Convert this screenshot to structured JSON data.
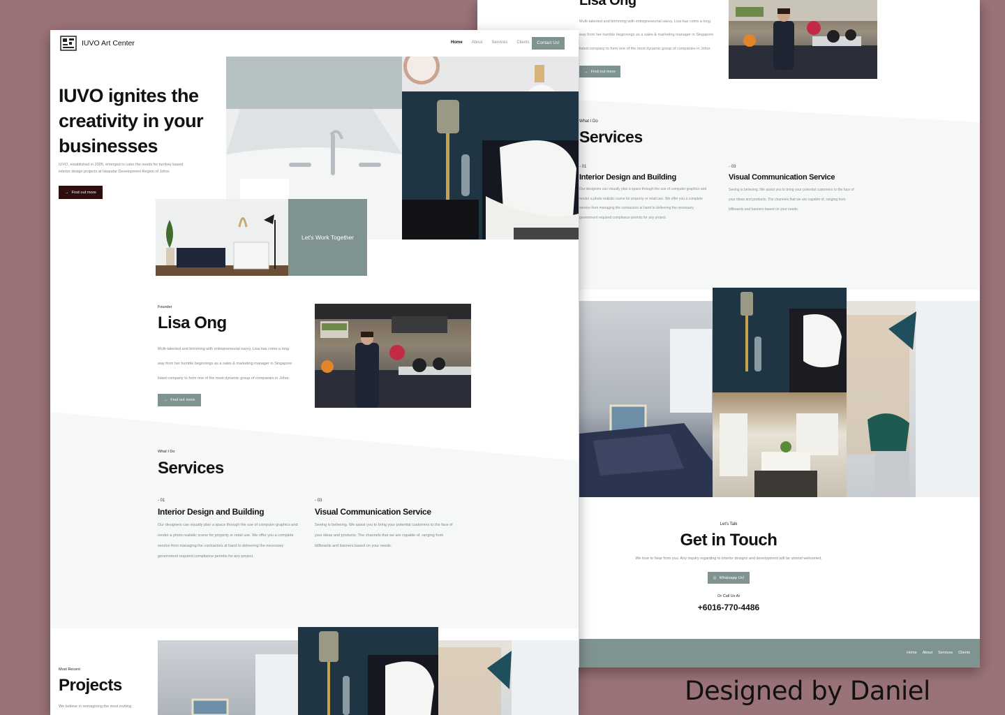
{
  "colors": {
    "backdrop": "#9a7378",
    "accent": "#7f9391",
    "dark_button": "#2e0e0e",
    "light_section": "#f6f8f7"
  },
  "brand": {
    "name": "IUVO Art Center",
    "logo_icon": "iuvo-logo-icon"
  },
  "nav": {
    "items": [
      "Home",
      "About",
      "Services",
      "Clients"
    ],
    "contact_label": "Contact Us!"
  },
  "hero": {
    "title_line1": "IUVO ignites the",
    "title_line2": "creativity in your",
    "title_line3": "businesses",
    "desc_line1": "IUVO, established in 2005, emerged to cater the needs for turnkey based",
    "desc_line2": "interior design projects at Iskandar Development Region of Johor.",
    "cta": "Find out more",
    "cta_icon": "arrow-right-icon",
    "work_together": "Let's Work Together"
  },
  "founder": {
    "eyebrow": "Founder",
    "name": "Lisa Ong",
    "desc_line1": "Multi-talented and brimming with entrepreneurial savvy, Lisa has come a long",
    "desc_line2": "way from her humble beginnings as a sales & marketing manager in Singapore",
    "desc_line3": "listed company to form one of the most dynamic group of companies in Johor.",
    "cta": "Find out more"
  },
  "services": {
    "eyebrow": "What I Do",
    "title": "Services",
    "items": [
      {
        "num": "- 01",
        "title": "Interior Design and Building",
        "line1": "Our designers can visually plan a space through the use of computer graphics and",
        "line2": "render a photo realistic scene for property or retail use. We offer you a complete",
        "line3": "service from managing the contractors at hand to delivering the necessary",
        "line4": "government required compliance permits for any project."
      },
      {
        "num": "- 03",
        "title": "Visual Communication Service",
        "line1": "Seeing is believing. We assist you to bring your potential customers to the face of",
        "line2": "your ideas and products. The channels that we are capable of, ranging from",
        "line3": "billboards and banners based on your needs."
      }
    ]
  },
  "projects": {
    "eyebrow": "Most Recent",
    "title": "Projects",
    "desc_line1": "We believe in reimagining the most inviting"
  },
  "contact": {
    "eyebrow": "Let's Talk",
    "title": "Get in Touch",
    "desc": "We love to hear from you. Any inquiry regarding to interior designs and development will be utmost welcomed.",
    "whatsapp": "Whatsapp Us!",
    "whatsapp_icon": "whatsapp-icon",
    "call_label": "Or Call Us At",
    "phone": "+6016-770-4486"
  },
  "footer": {
    "items": [
      "Home",
      "About",
      "Services",
      "Clients"
    ]
  },
  "caption": "Designed by Daniel"
}
